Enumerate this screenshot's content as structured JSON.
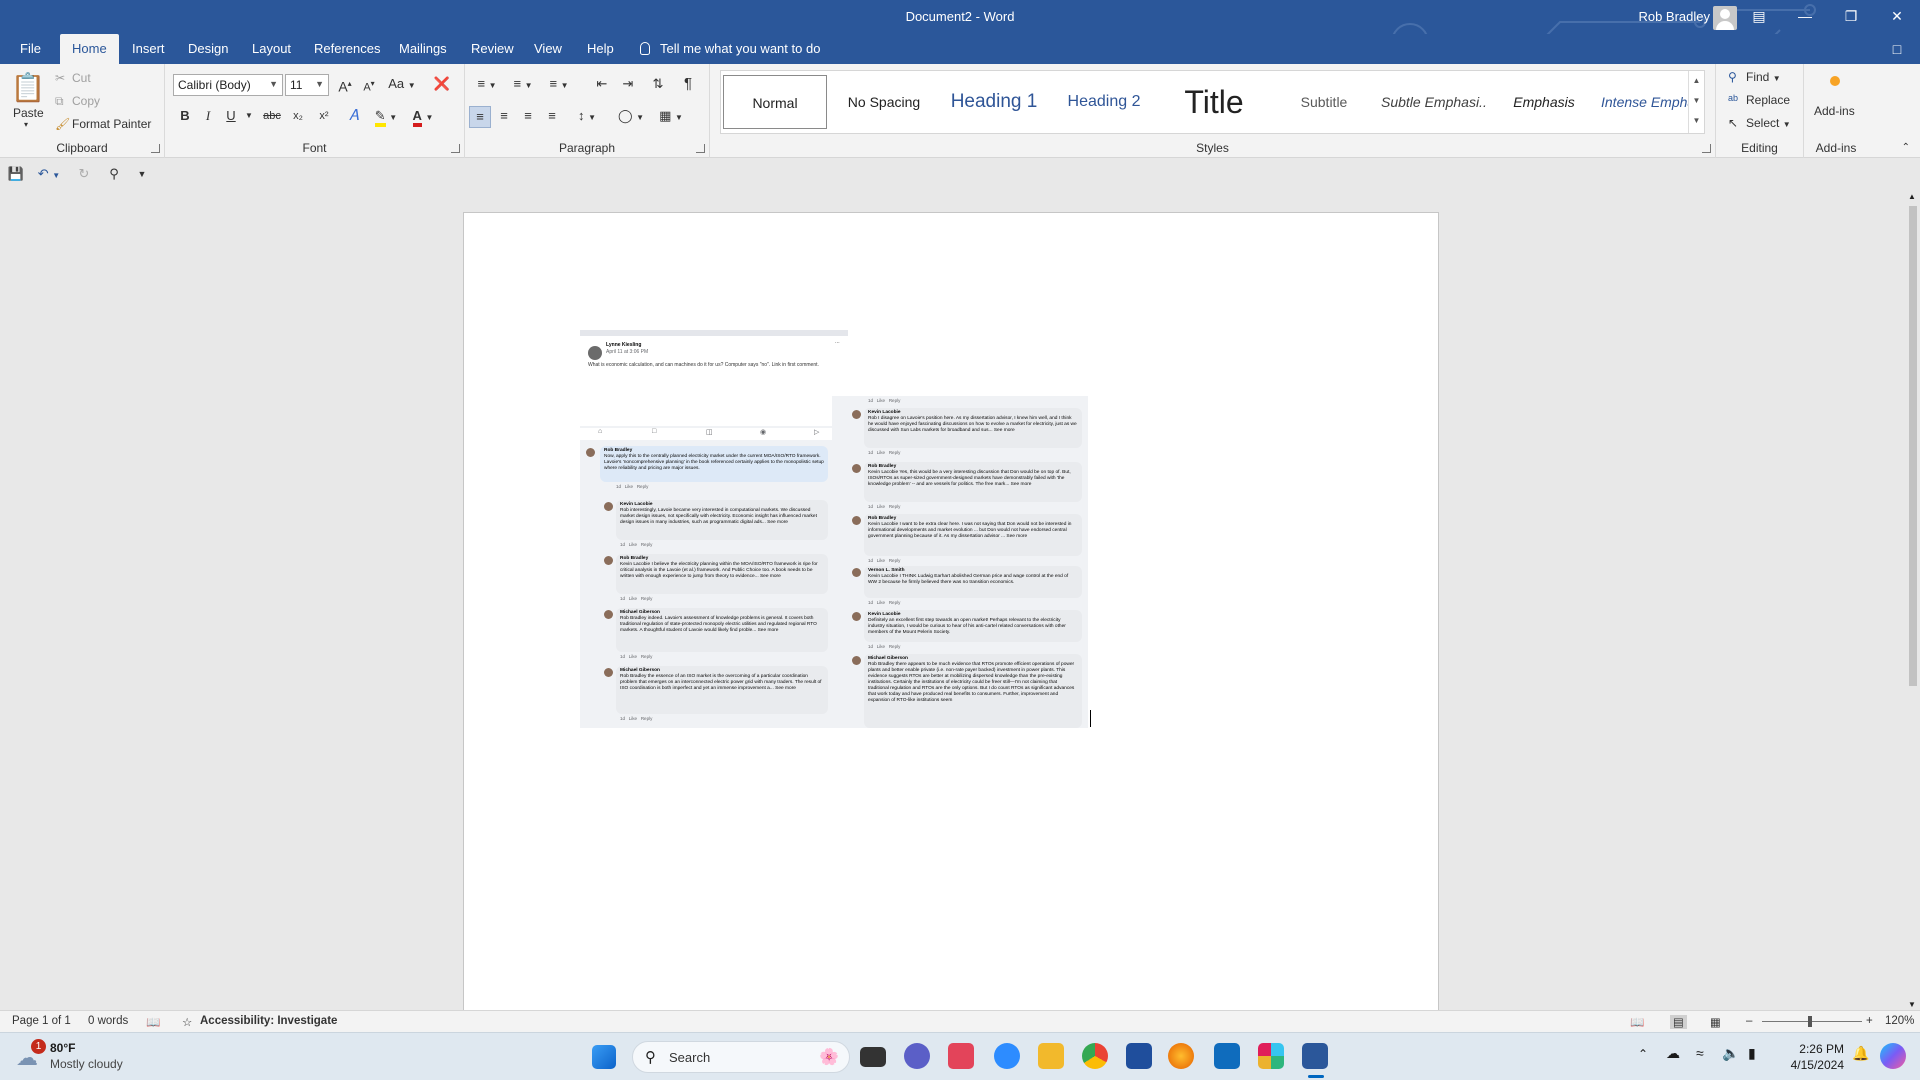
{
  "window": {
    "title": "Document2 - Word",
    "user_name": "Rob Bradley",
    "controls": [
      "ribbon-display",
      "minimize",
      "restore",
      "close"
    ]
  },
  "tabs": [
    {
      "label": "File",
      "active": false
    },
    {
      "label": "Home",
      "active": true
    },
    {
      "label": "Insert",
      "active": false
    },
    {
      "label": "Design",
      "active": false
    },
    {
      "label": "Layout",
      "active": false
    },
    {
      "label": "References",
      "active": false
    },
    {
      "label": "Mailings",
      "active": false
    },
    {
      "label": "Review",
      "active": false
    },
    {
      "label": "View",
      "active": false
    },
    {
      "label": "Help",
      "active": false
    }
  ],
  "tell_me": "Tell me what you want to do",
  "ribbon": {
    "clipboard": {
      "label": "Clipboard",
      "paste": "Paste",
      "cut": "Cut",
      "copy": "Copy",
      "format_painter": "Format Painter"
    },
    "font": {
      "label": "Font",
      "font_name": "Calibri (Body)",
      "font_size": "11",
      "bold": "B",
      "italic": "I",
      "underline": "U",
      "strike": "abc",
      "subscript": "x₂",
      "superscript": "x²",
      "case": "Aa",
      "grow": "A",
      "shrink": "A"
    },
    "paragraph": {
      "label": "Paragraph",
      "pilcrow": "¶"
    },
    "styles": {
      "label": "Styles",
      "items": [
        {
          "label": "Normal",
          "selected": true
        },
        {
          "label": "No Spacing",
          "selected": false
        },
        {
          "label": "Heading 1",
          "selected": false
        },
        {
          "label": "Heading 2",
          "selected": false
        },
        {
          "label": "Title",
          "selected": false
        },
        {
          "label": "Subtitle",
          "selected": false
        },
        {
          "label": "Subtle Emphasi...",
          "selected": false
        },
        {
          "label": "Emphasis",
          "selected": false
        },
        {
          "label": "Intense Emphas...",
          "selected": false
        }
      ]
    },
    "editing": {
      "label": "Editing",
      "find": "Find",
      "replace": "Replace",
      "select": "Select"
    },
    "addins": {
      "label": "Add-ins",
      "button": "Add-ins"
    }
  },
  "document": {
    "post": {
      "author": "Lynne Kiesling",
      "date": "April 11 at 3:06 PM",
      "text": "What is economic calculation, and can machines do it for us? Computer says \"no\". Link in first comment."
    },
    "comments_left": [
      {
        "author": "Rob Bradley",
        "text": "Now, apply this to the centrally planned electricity market under the current MOA/ISO/RTO framework. Lavoie's 'noncomprehensive planning' in the book referenced certainly applies to the monopolistic setup where reliability and pricing are major issues."
      },
      {
        "author": "Kevin Lacobie",
        "text": "Rob interestingly, Lavoie became very interested in computational markets. We discussed market design issues, not specifically with electricity. Economic insight has influenced market design issues in many industries, such as programmatic digital ads... See more"
      },
      {
        "author": "Rob Bradley",
        "text": "Kevin Lacobie I believe the electricity planning within the MOA/ISO/RTO framework is ripe for critical analysis in the Lavoie (et al.) framework. And Public Choice too. A book needs to be written with enough experience to jump from theory to evidence... See more"
      },
      {
        "author": "Michael Giberson",
        "text": "Rob Bradley indeed. Lavoie's assessment of knowledge problems is general. It covers both traditional regulation of state-protected monopoly electric utilities and regulated regional RTO markets. A thoughtful student of Lavoie would likely find proble... See more"
      },
      {
        "author": "Michael Giberson",
        "text": "Rob Bradley the essence of an ISO market is the overcoming of a particular coordination problem that emerges on an interconnected electric power grid with many traders. The result of ISO coordination is both imperfect and yet an immense improvement a... See more"
      }
    ],
    "comments_right": [
      {
        "author": "Kevin Lacobie",
        "text": "Rob I disagree on Lavoie's position here. As my dissertation advisor, I knew him well, and I think he would have enjoyed fascinating discussions on how to evolve a market for electricity, just as we discussed with Sun Labs markets for broadband and sus... See more"
      },
      {
        "author": "Rob Bradley",
        "text": "Kevin Lacobie Yes, this would be a very interesting discussion that Don would be on top of. But, ISOs/RTOs as super-sized government-designed markets have demonstrably failed with 'the knowledge problem' -- and are vessels for politics. The free mark... See more"
      },
      {
        "author": "Rob Bradley",
        "text": "Kevin Lacobie I want to be extra clear here. I was not saying that Don would not be interested in informational developments and market evolution ... but Don would not have endorsed central government planning because of it. As my dissertation advisor ... See more"
      },
      {
        "author": "Vernon L. Smith",
        "text": "Kevin Lacobie I THINK Ludwig Earhart abolished German price and wage control at the end of WW 2 because he firmly believed there was no transition economics."
      },
      {
        "author": "Kevin Lacobie",
        "text": "Definitely an excellent first step towards an open market! Perhaps relevant to the electricity industry situation, I would be curious to hear of his anti-cartel related conversations with other members of the Mount Pelerin Society."
      },
      {
        "author": "Michael Giberson",
        "text": "Rob Bradley there appears to be much evidence that RTOs promote efficient operations of power plants and better enable private (i.e. non-rate payer backed) investment in power plants. This evidence suggests RTOs are better at mobilizing dispersed knowledge than the pre-existing institutions. Certainly the institutions of electricity could be freer still—I'm not claiming that traditional regulation and RTOs are the only options. But I do count RTOs as significant advances that work today and have produced real benefits to consumers. Further, improvement and expansion of RTO-like institutions seem"
      }
    ],
    "meta_actions": [
      "1d",
      "Like",
      "Reply"
    ],
    "see_more": "See more"
  },
  "statusbar": {
    "page": "Page 1 of 1",
    "words": "0 words",
    "accessibility": "Accessibility: Investigate",
    "zoom": "120%"
  },
  "taskbar": {
    "weather_temp": "80°F",
    "weather_desc": "Mostly cloudy",
    "weather_badge": "1",
    "search": "Search",
    "time": "2:26 PM",
    "date": "4/15/2024"
  }
}
